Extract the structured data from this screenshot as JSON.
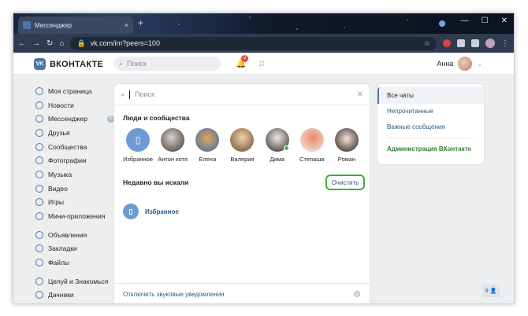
{
  "browser": {
    "tab_title": "Мессенджер",
    "tab_close": "×",
    "new_tab": "+",
    "url": "vk.com/im?peers=100",
    "window_buttons": [
      "—",
      "☐",
      "✕"
    ]
  },
  "header": {
    "logo_text": "ВКОНТАКТЕ",
    "logo_mark": "VK",
    "search_placeholder": "Поиск",
    "notifications_count": "2",
    "user_name": "Анна"
  },
  "menu": {
    "items": [
      {
        "label": "Моя страница",
        "icon": "user-icon"
      },
      {
        "label": "Новости",
        "icon": "news-icon"
      },
      {
        "label": "Мессенджер",
        "icon": "chat-icon",
        "count": "5"
      },
      {
        "label": "Друзья",
        "icon": "friends-icon"
      },
      {
        "label": "Сообщества",
        "icon": "groups-icon"
      },
      {
        "label": "Фотографии",
        "icon": "photo-icon"
      },
      {
        "label": "Музыка",
        "icon": "music-icon"
      },
      {
        "label": "Видео",
        "icon": "video-icon"
      },
      {
        "label": "Игры",
        "icon": "games-icon"
      },
      {
        "label": "Мини-приложения",
        "icon": "apps-icon"
      }
    ],
    "items2": [
      {
        "label": "Объявления",
        "icon": "ads-icon"
      },
      {
        "label": "Закладки",
        "icon": "bookmark-icon"
      },
      {
        "label": "Файлы",
        "icon": "files-icon"
      }
    ],
    "items3": [
      {
        "label": "Целуй и Знакомься",
        "icon": "app-icon"
      },
      {
        "label": "Дачники",
        "icon": "app-icon"
      }
    ]
  },
  "main": {
    "search_placeholder": "Поиск",
    "people_title": "Люди и сообщества",
    "people": [
      {
        "name": "Избранное"
      },
      {
        "name": "Антон котя"
      },
      {
        "name": "Елена"
      },
      {
        "name": "Валерия"
      },
      {
        "name": "Дима"
      },
      {
        "name": "Степаша"
      },
      {
        "name": "Роман"
      }
    ],
    "recent_title": "Недавно вы искали",
    "clear_label": "Очистить",
    "recent_item": "Избранное",
    "footer_text": "Отключить звуковые уведомления"
  },
  "right": {
    "items": [
      "Все чаты",
      "Непрочитанные",
      "Важные сообщения"
    ],
    "admin": "Администрация ВКонтакте"
  },
  "corner_badge": "9 👤",
  "colors": {
    "brand": "#4a76a8",
    "link": "#2a5885",
    "highlight": "#3fad3f"
  }
}
